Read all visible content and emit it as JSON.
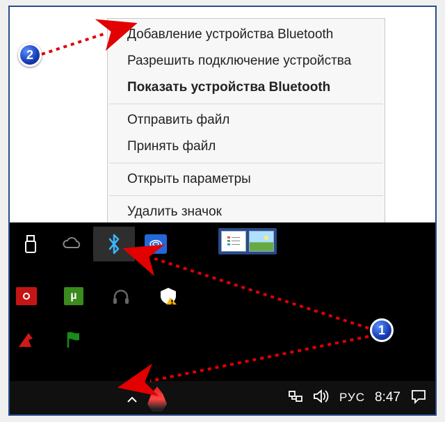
{
  "menu": {
    "items": [
      "Добавление устройства Bluetooth",
      "Разрешить подключение устройства",
      "Показать устройства Bluetooth",
      "Отправить файл",
      "Принять файл",
      "Открыть параметры",
      "Удалить значок"
    ]
  },
  "taskbar": {
    "language": "РУС",
    "clock": "8:47"
  },
  "annotations": {
    "badge1": "1",
    "badge2": "2"
  }
}
